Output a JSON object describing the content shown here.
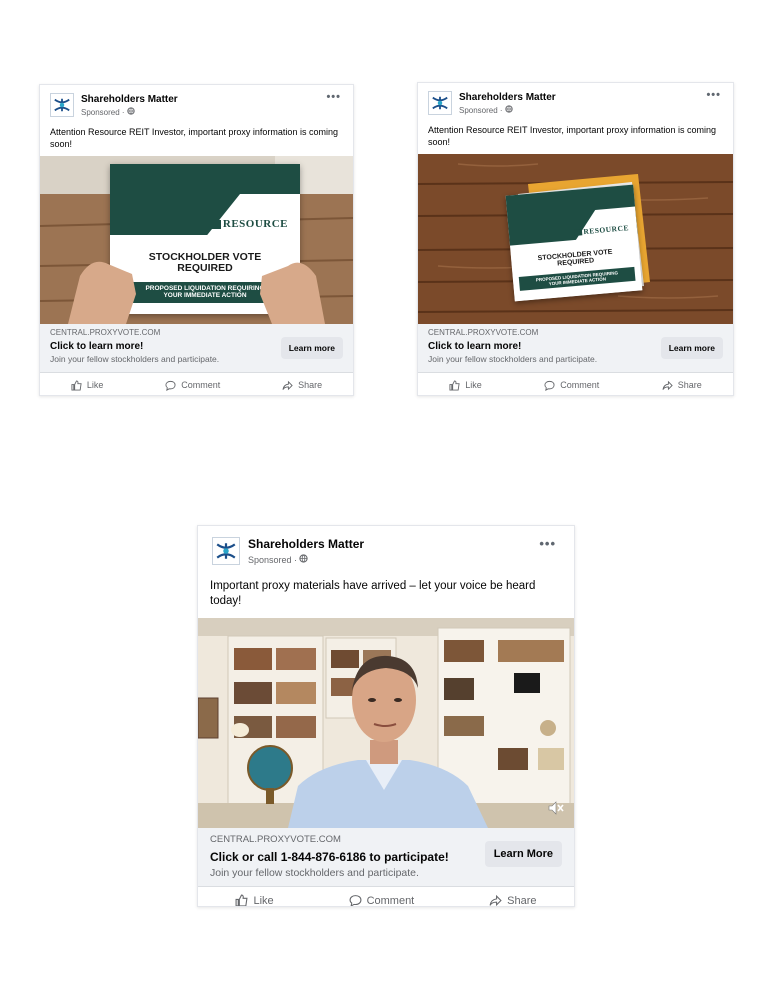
{
  "posts": [
    {
      "page_name": "Shareholders Matter",
      "sponsored": "Sponsored ·",
      "message": "Attention Resource REIT Investor, important proxy information is coming soon!",
      "card": {
        "brand": "RESOURCE",
        "vote_line1": "STOCKHOLDER VOTE",
        "vote_line2": "REQUIRED",
        "band_line1": "PROPOSED LIQUIDATION REQUIRING",
        "band_line2": "YOUR IMMEDIATE ACTION"
      },
      "domain": "CENTRAL.PROXYVOTE.COM",
      "cta_title": "Click to learn more!",
      "cta_desc": "Join your fellow stockholders and participate.",
      "button": "Learn more",
      "like": "Like",
      "comment": "Comment",
      "share": "Share"
    },
    {
      "page_name": "Shareholders Matter",
      "sponsored": "Sponsored ·",
      "message": "Attention Resource REIT Investor, important proxy information is coming soon!",
      "card": {
        "brand": "RESOURCE",
        "vote_line1": "STOCKHOLDER VOTE",
        "vote_line2": "REQUIRED",
        "band_line1": "PROPOSED LIQUIDATION REQUIRING",
        "band_line2": "YOUR IMMEDIATE ACTION"
      },
      "domain": "CENTRAL.PROXYVOTE.COM",
      "cta_title": "Click to learn more!",
      "cta_desc": "Join your fellow stockholders and participate.",
      "button": "Learn more",
      "like": "Like",
      "comment": "Comment",
      "share": "Share"
    },
    {
      "page_name": "Shareholders Matter",
      "sponsored": "Sponsored ·",
      "message": "Important proxy materials have arrived – let your voice be heard today!",
      "domain": "CENTRAL.PROXYVOTE.COM",
      "cta_title": "Click or call 1-844-876-6186 to participate!",
      "cta_desc": "Join your fellow stockholders and participate.",
      "button": "Learn More",
      "like": "Like",
      "comment": "Comment",
      "share": "Share"
    }
  ],
  "colors": {
    "brand_green": "#1e4d43",
    "wood": "#7b4a2a",
    "facebook_gray": "#65676b"
  },
  "icons": [
    "globe-icon",
    "more-icon",
    "like-icon",
    "comment-icon",
    "share-icon",
    "mute-icon"
  ]
}
